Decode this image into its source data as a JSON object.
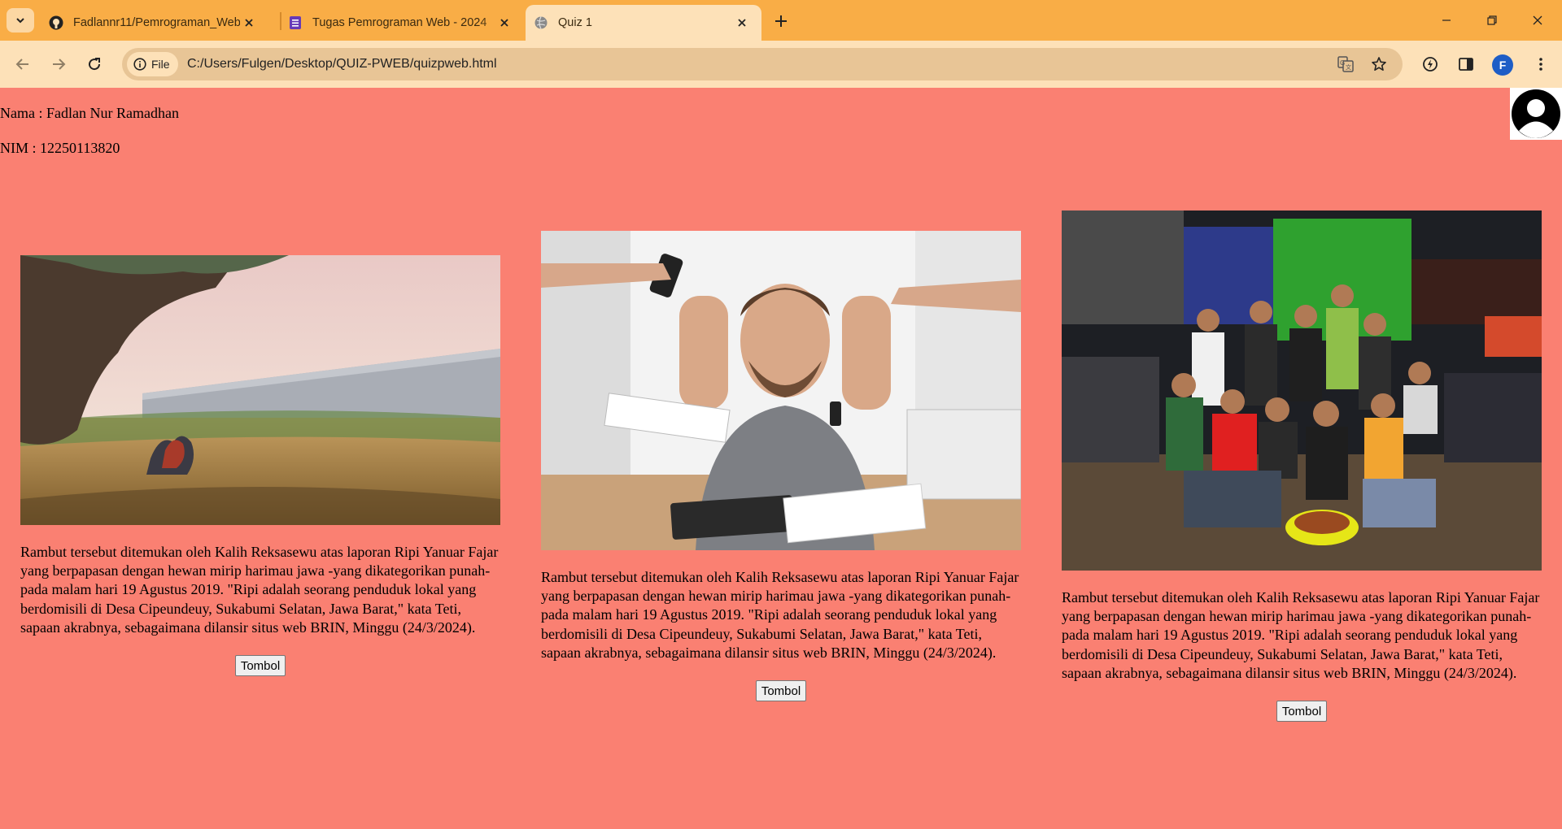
{
  "browser": {
    "tabs": [
      {
        "title": "Fadlannr11/Pemrograman_Web",
        "icon": "github-icon"
      },
      {
        "title": "Tugas Pemrograman Web - 2024",
        "icon": "forms-icon"
      },
      {
        "title": "Quiz 1",
        "icon": "globe-icon",
        "active": true
      }
    ],
    "chip_label": "File",
    "url": "C:/Users/Fulgen/Desktop/QUIZ-PWEB/quizpweb.html",
    "profile_initial": "F"
  },
  "page": {
    "name_line": "Nama : Fadlan Nur Ramadhan",
    "nim_line": "NIM : 12250113820",
    "cards": [
      {
        "photo": "illustration of a couple sitting in a grass field under a large tree near a tall wall",
        "text": "Rambut tersebut ditemukan oleh Kalih Reksasewu atas laporan Ripi Yanuar Fajar yang berpapasan dengan hewan mirip harimau jawa -yang dikategorikan punah- pada malam hari 19 Agustus 2019. \"Ripi adalah seorang penduduk lokal yang berdomisili di Desa Cipeundeuy, Sukabumi Selatan, Jawa Barat,\" kata Teti, sapaan akrabnya, sebagaimana dilansir situs web BRIN, Minggu (24/3/2024).",
        "button": "Tombol"
      },
      {
        "photo": "stressed man at a desk surrounded by hands holding phone, papers and watch",
        "text": "Rambut tersebut ditemukan oleh Kalih Reksasewu atas laporan Ripi Yanuar Fajar yang berpapasan dengan hewan mirip harimau jawa -yang dikategorikan punah- pada malam hari 19 Agustus 2019. \"Ripi adalah seorang penduduk lokal yang berdomisili di Desa Cipeundeuy, Sukabumi Selatan, Jawa Barat,\" kata Teti, sapaan akrabnya, sebagaimana dilansir situs web BRIN, Minggu (24/3/2024).",
        "button": "Tombol"
      },
      {
        "photo": "group of young men posing at night with motorcycles, a guitar and a bowl of food",
        "text": "Rambut tersebut ditemukan oleh Kalih Reksasewu atas laporan Ripi Yanuar Fajar yang berpapasan dengan hewan mirip harimau jawa -yang dikategorikan punah- pada malam hari 19 Agustus 2019. \"Ripi adalah seorang penduduk lokal yang berdomisili di Desa Cipeundeuy, Sukabumi Selatan, Jawa Barat,\" kata Teti, sapaan akrabnya, sebagaimana dilansir situs web BRIN, Minggu (24/3/2024).",
        "button": "Tombol"
      }
    ]
  },
  "colors": {
    "page_background": "#fa8072",
    "tabbar": "#f9ad46",
    "toolbar": "#fde1b8"
  }
}
